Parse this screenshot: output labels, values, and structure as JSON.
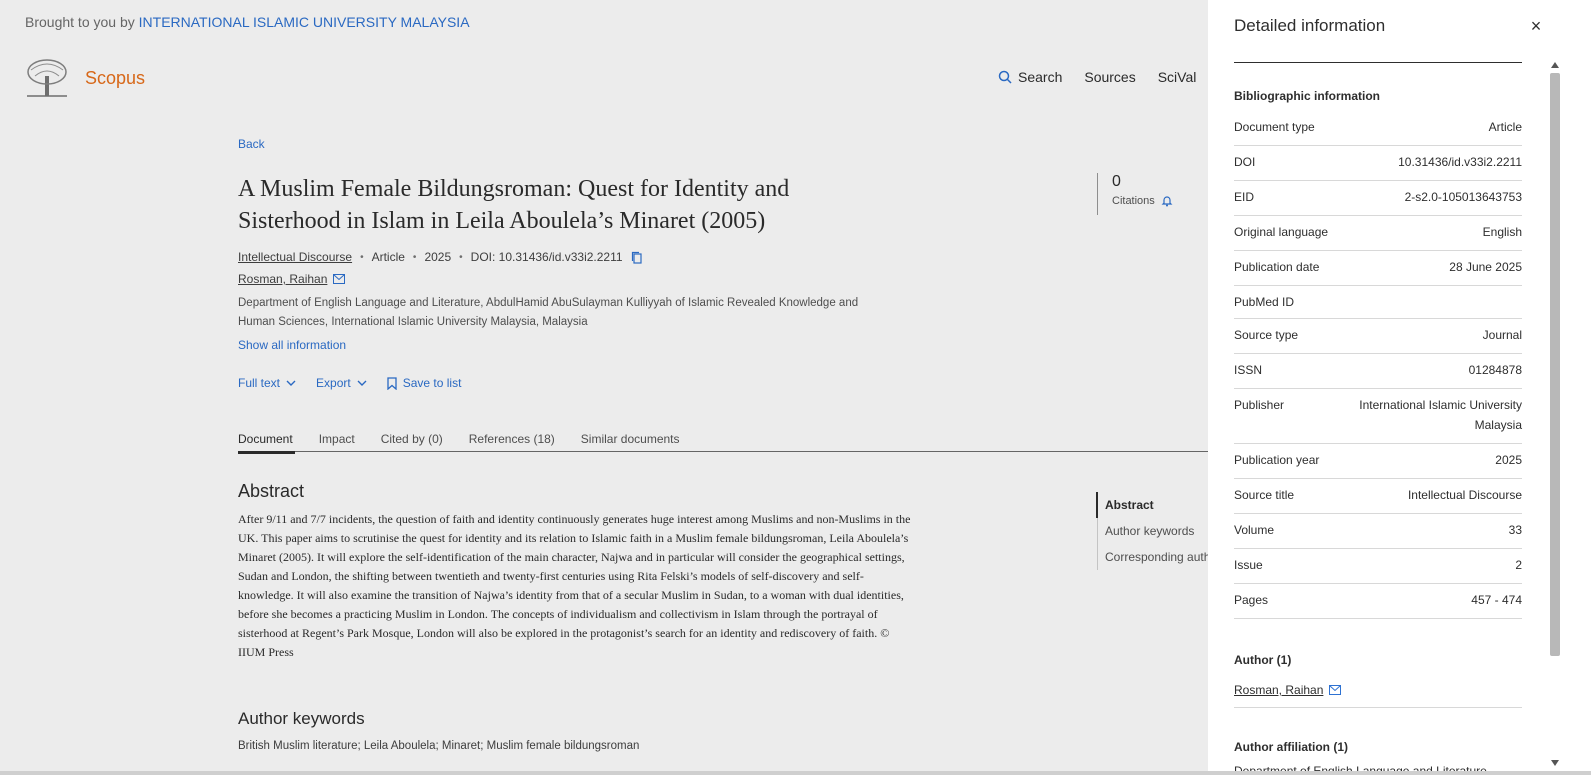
{
  "header": {
    "brought_prefix": "Brought to you by",
    "institution": "INTERNATIONAL ISLAMIC UNIVERSITY MALAYSIA",
    "brand": "Scopus",
    "nav": {
      "search": "Search",
      "sources": "Sources",
      "scival": "SciVal"
    }
  },
  "article": {
    "back": "Back",
    "title": "A Muslim Female Bildungsroman: Quest for Identity and Sisterhood in Islam in Leila Aboulela’s Minaret (2005)",
    "citations_count": "0",
    "citations_label": "Citations",
    "journal": "Intellectual Discourse",
    "type": "Article",
    "year": "2025",
    "doi": "DOI: 10.31436/id.v33i2.2211",
    "author": "Rosman, Raihan",
    "affiliation": "Department of English Language and Literature, AbdulHamid AbuSulayman Kulliyyah of Islamic Revealed Knowledge and Human Sciences, International Islamic University Malaysia, Malaysia",
    "show_all": "Show all information",
    "actions": {
      "full_text": "Full text",
      "export": "Export",
      "save": "Save to list"
    },
    "tabs": [
      "Document",
      "Impact",
      "Cited by (0)",
      "References (18)",
      "Similar documents"
    ],
    "abstract_heading": "Abstract",
    "abstract": "After 9/11 and 7/7 incidents, the question of faith and identity continuously generates huge interest among Muslims and non-Muslims in the UK. This paper aims to scrutinise the quest for identity and its relation to Islamic faith in a Muslim female bildungsroman, Leila Aboulela’s Minaret (2005). It will explore the self-identification of the main character, Najwa and in particular will consider the geographical settings, Sudan and London, the shifting between twentieth and twenty-first centuries using Rita Felski’s models of self-discovery and self-knowledge. It will also examine the transition of Najwa’s identity from that of a secular Muslim in Sudan, to a woman with dual identities, before she becomes a practicing Muslim in London. The concepts of individualism and collectivism in Islam through the portrayal of sisterhood at Regent’s Park Mosque, London will also be explored in the protagonist’s search for an identity and rediscovery of faith. © IIUM Press",
    "toc": [
      "Abstract",
      "Author keywords",
      "Corresponding auth"
    ],
    "keywords_heading": "Author keywords",
    "keywords": "British Muslim literature; Leila Aboulela; Minaret; Muslim female bildungsroman"
  },
  "panel": {
    "title": "Detailed information",
    "close": "×",
    "bib_heading": "Bibliographic information",
    "rows": [
      {
        "k": "Document type",
        "v": "Article"
      },
      {
        "k": "DOI",
        "v": "10.31436/id.v33i2.2211"
      },
      {
        "k": "EID",
        "v": "2-s2.0-105013643753"
      },
      {
        "k": "Original language",
        "v": "English"
      },
      {
        "k": "Publication date",
        "v": "28 June 2025"
      },
      {
        "k": "PubMed ID",
        "v": ""
      },
      {
        "k": "Source type",
        "v": "Journal"
      },
      {
        "k": "ISSN",
        "v": "01284878"
      },
      {
        "k": "Publisher",
        "v": "International Islamic University Malaysia"
      },
      {
        "k": "Publication year",
        "v": "2025"
      },
      {
        "k": "Source title",
        "v": "Intellectual Discourse"
      },
      {
        "k": "Volume",
        "v": "33"
      },
      {
        "k": "Issue",
        "v": "2"
      },
      {
        "k": "Pages",
        "v": "457 - 474"
      }
    ],
    "author_heading": "Author (1)",
    "author": "Rosman, Raihan",
    "affil_heading": "Author affiliation (1)",
    "affil_text": "Department of English Language and Literature,"
  },
  "colors": {
    "link": "#2e72d2",
    "brand": "#e9711c"
  }
}
